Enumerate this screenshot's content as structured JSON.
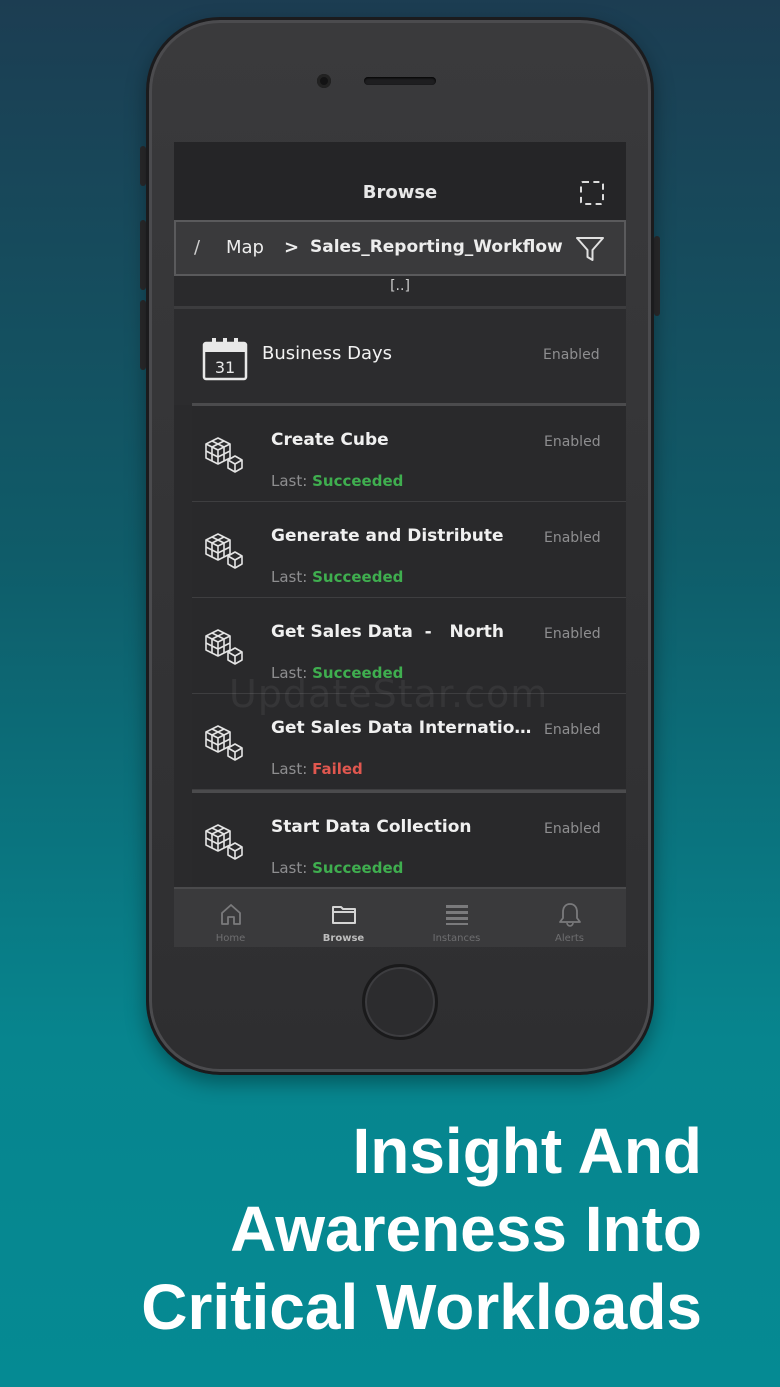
{
  "navbar": {
    "title": "Browse",
    "expand_icon": "expand-dashed-square-icon"
  },
  "breadcrumb": {
    "root": "/",
    "parent": "Map",
    "separator": ">",
    "current": "Sales_Reporting_Workflow",
    "filter_icon": "filter-funnel-icon"
  },
  "parent_link": "[..]",
  "business_days": {
    "title": "Business Days",
    "calendar_day": "31",
    "status": "Enabled",
    "icon": "calendar-icon"
  },
  "jobs": [
    {
      "title": "Create Cube",
      "status": "Enabled",
      "last_label": "Last:",
      "last_result": "Succeeded",
      "icon": "cube-workflow-icon"
    },
    {
      "title": "Generate and Distribute",
      "status": "Enabled",
      "last_label": "Last:",
      "last_result": "Succeeded",
      "icon": "cube-workflow-icon"
    },
    {
      "title": "Get Sales Data  -   North",
      "status": "Enabled",
      "last_label": "Last:",
      "last_result": "Succeeded",
      "icon": "cube-workflow-icon"
    },
    {
      "title": "Get Sales Data Internatio...",
      "status": "Enabled",
      "last_label": "Last:",
      "last_result": "Failed",
      "icon": "cube-workflow-icon"
    },
    {
      "title": "Start Data Collection",
      "status": "Enabled",
      "last_label": "Last:",
      "last_result": "Succeeded",
      "icon": "cube-workflow-icon"
    }
  ],
  "tabs": [
    {
      "label": "Home",
      "icon": "home-icon",
      "active": false
    },
    {
      "label": "Browse",
      "icon": "folder-icon",
      "active": true
    },
    {
      "label": "Instances",
      "icon": "list-icon",
      "active": false
    },
    {
      "label": "Alerts",
      "icon": "bell-icon",
      "active": false
    }
  ],
  "watermark": "UpdateStar.com",
  "headline": {
    "line1": "Insight And",
    "line2": "Awareness Into",
    "line3": "Critical Workloads"
  },
  "colors": {
    "success": "#3fae4f",
    "failed": "#e0574f",
    "background_top": "#1c3d52",
    "background_bottom": "#058a93"
  }
}
